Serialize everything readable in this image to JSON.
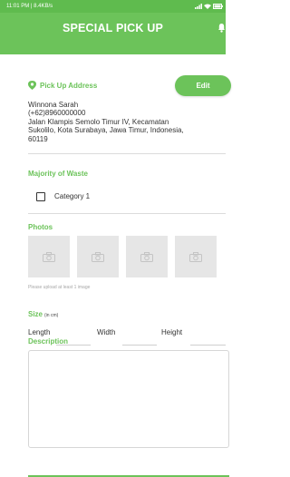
{
  "status_bar": {
    "time_speed": "11:01 PM | 8.4KB/s",
    "battery": "100"
  },
  "header": {
    "title": "SPECIAL PICK UP"
  },
  "pickup": {
    "label": "Pick Up Address",
    "edit_label": "Edit",
    "name": "Winnona Sarah",
    "phone": "(+62)8960000000",
    "address_line1": "Jalan Klampis Semolo Timur IV, Kecamatan",
    "address_line2": "Sukolilo, Kota Surabaya, Jawa Timur, Indonesia,",
    "postal_code": "60119"
  },
  "waste": {
    "label": "Majority of Waste",
    "option": "Category 1",
    "checked": false
  },
  "photos": {
    "label": "Photos",
    "hint": "Please upload at least 1 image"
  },
  "size": {
    "label": "Size",
    "unit": "(in cm)",
    "length": "Length",
    "width": "Width",
    "height": "Height"
  },
  "description": {
    "label": "Description"
  },
  "colors": {
    "primary": "#6cc35a",
    "status_bar": "#5fbb4e",
    "photo_placeholder": "#e6e6e6"
  },
  "icons": [
    "location-pin-icon",
    "bell-icon",
    "camera-icon",
    "wifi-icon",
    "signal-icon",
    "battery-icon"
  ]
}
